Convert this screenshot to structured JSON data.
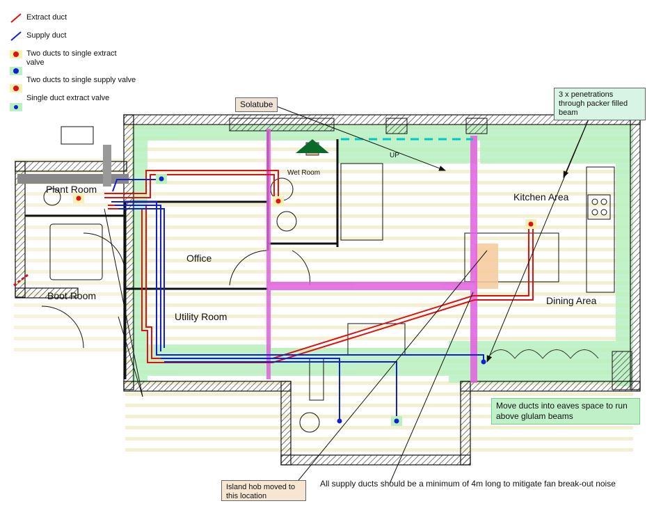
{
  "legend": [
    {
      "label": "Extract duct",
      "icon": "red-line-icon"
    },
    {
      "label": "Supply duct",
      "icon": "blue-line-icon"
    },
    {
      "label": "Two ducts to single extract valve",
      "icon": "extract-valve-double-icon"
    },
    {
      "label": "Two ducts to single supply valve",
      "icon": "supply-valve-double-icon"
    },
    {
      "label": "Single duct extract valve",
      "icon": "extract-valve-single-icon"
    }
  ],
  "rooms": {
    "plant_room": "Plant Room",
    "boot_room": "Boot Room",
    "office": "Office",
    "utility_room": "Utility Room",
    "wet_room": "Wet Room",
    "kitchen_area": "Kitchen Area",
    "dining_area": "Dining Area",
    "up": "UP"
  },
  "callouts": {
    "solatube": "Solatube",
    "penetrations": "3 x penetrations through packer filled beam",
    "eaves": "Move ducts into eaves space to run above glulam beams",
    "island_hob": "Island hob moved to this location",
    "min_length_note": "All supply ducts should be a minimum of 4m long to mitigate fan break-out noise"
  },
  "colors": {
    "extract": "#e01010",
    "supply": "#1020d0",
    "green_zone": "#b8f0c0",
    "magenta_beam": "#e060e0",
    "callout_fill": "#d8f4e4",
    "solatube_fill": "#efe3d6",
    "hob_fill": "#f6e6d2"
  }
}
